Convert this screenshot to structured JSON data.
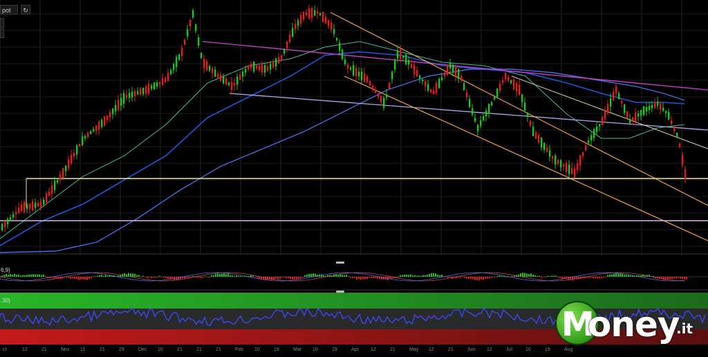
{
  "toolbar": {
    "symbol_label": "pot",
    "refresh_icon": "refresh-icon",
    "expand_icon": "expand-icon",
    "zoom_in_icon": "plus-icon",
    "zoom_out_icon": "minus-icon"
  },
  "indicators": {
    "macd_label": "6,9)",
    "rsi_label": ",30)"
  },
  "x_axis_ticks": [
    "ct",
    "12",
    "21",
    "Nov",
    "11",
    "21",
    "29",
    "Dec",
    "10",
    "21",
    "21",
    "21",
    "Feb",
    "10",
    "19",
    "Mar",
    "10",
    "19",
    "Apr",
    "12",
    "21",
    "May",
    "12",
    "21",
    "Jun",
    "12",
    "Jul",
    "10",
    "19",
    "Aug"
  ],
  "watermark": {
    "brand": "oney",
    "tld": ".it",
    "logo_letter": "M"
  },
  "colors": {
    "background": "#000000",
    "bull_candle": "#22c322",
    "bear_candle": "#e02020",
    "channel": "#f5a040",
    "resistance": "#d040d0",
    "support_line": "#b0a8f0",
    "horizontal_yellow": "#f0e890",
    "horizontal_violet": "#d8b8f0",
    "ma_fast": "#3fbf9f",
    "ma_slow": "#1e58d8",
    "ma_long": "#4a6adf",
    "rsi_line": "#3a4cff",
    "rsi_top_zone": "#2fbf2f",
    "rsi_bottom_zone": "#c42020"
  }
}
